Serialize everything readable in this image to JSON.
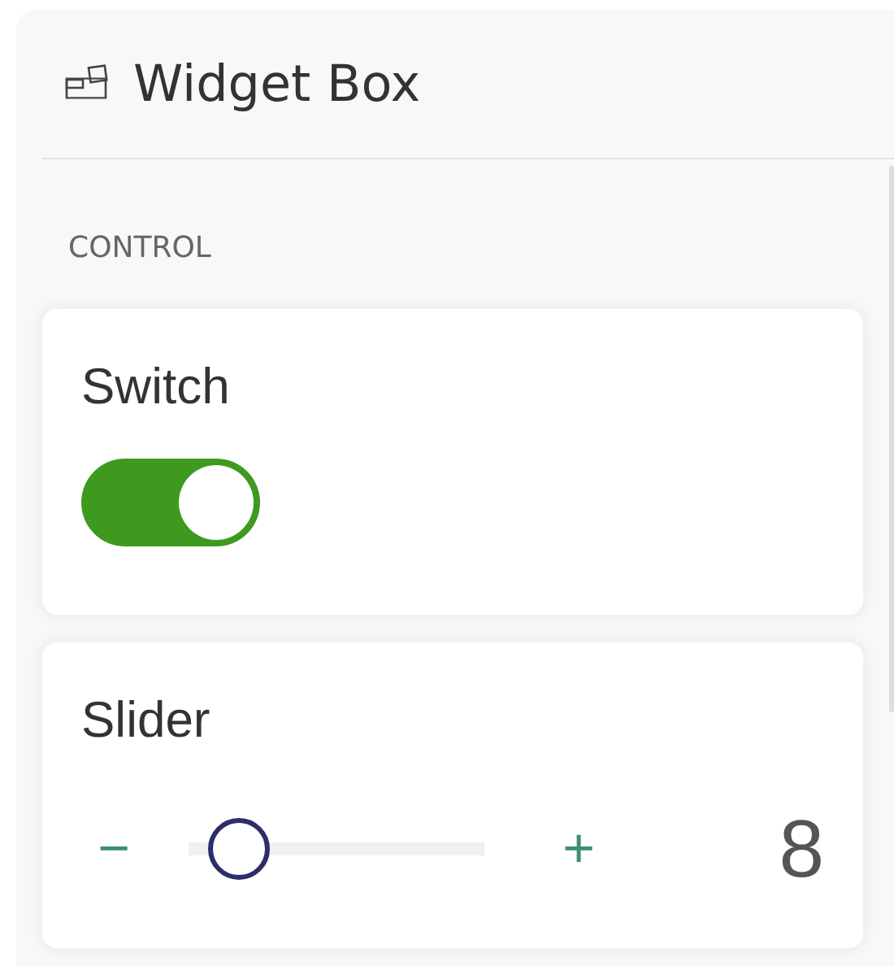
{
  "panel": {
    "title": "Widget Box"
  },
  "section": "CONTROL",
  "widgets": [
    {
      "kind": "switch",
      "label": "Switch",
      "on": true
    },
    {
      "kind": "slider",
      "label": "Slider",
      "decrement": "−",
      "increment": "+",
      "level": 0.08,
      "value": "8"
    }
  ]
}
